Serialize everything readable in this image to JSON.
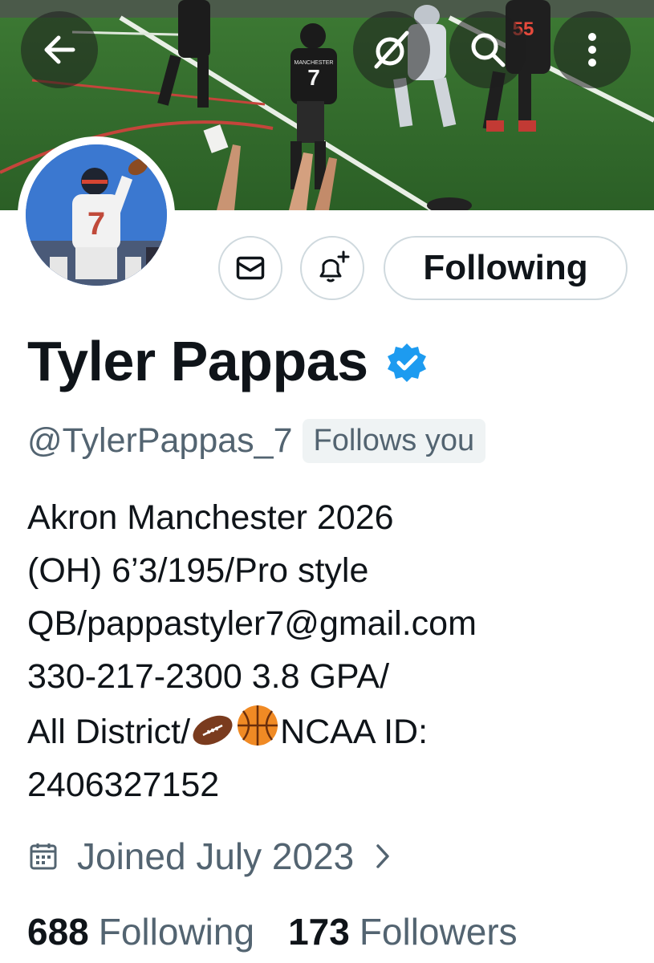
{
  "header": {
    "back_icon": "arrow-left-icon",
    "grok_icon": "slash-circle-icon",
    "search_icon": "search-icon",
    "more_icon": "vertical-ellipsis-icon"
  },
  "banner": {
    "jersey_front_text": "MANCHESTER",
    "jersey_front_number": "7",
    "jersey_back_number": "55"
  },
  "avatar": {
    "jersey_number": "7"
  },
  "actions": {
    "message_icon": "envelope-icon",
    "notify_icon": "bell-plus-icon",
    "follow_label": "Following"
  },
  "profile": {
    "display_name": "Tyler Pappas",
    "verified_badge_color": "#1d9bf0",
    "handle": "@TylerPappas_7",
    "follows_you": "Follows you",
    "bio": {
      "line1": "Akron Manchester 2026",
      "line2": "(OH) 6’3/195/Pro style",
      "line3": "QB/pappastyler7@gmail.com",
      "line4": "330-217-2300 3.8 GPA/",
      "line5_a": "All District/",
      "line5_b": "NCAA ID:",
      "line6": "2406327152"
    },
    "joined_icon": "calendar-icon",
    "joined": "Joined July 2023",
    "following_count": "688",
    "following_label": "Following",
    "followers_count": "173",
    "followers_label": "Followers"
  },
  "colors": {
    "text": "#0f1419",
    "secondary": "#536471",
    "border": "#cfd9de",
    "accent": "#1d9bf0"
  }
}
